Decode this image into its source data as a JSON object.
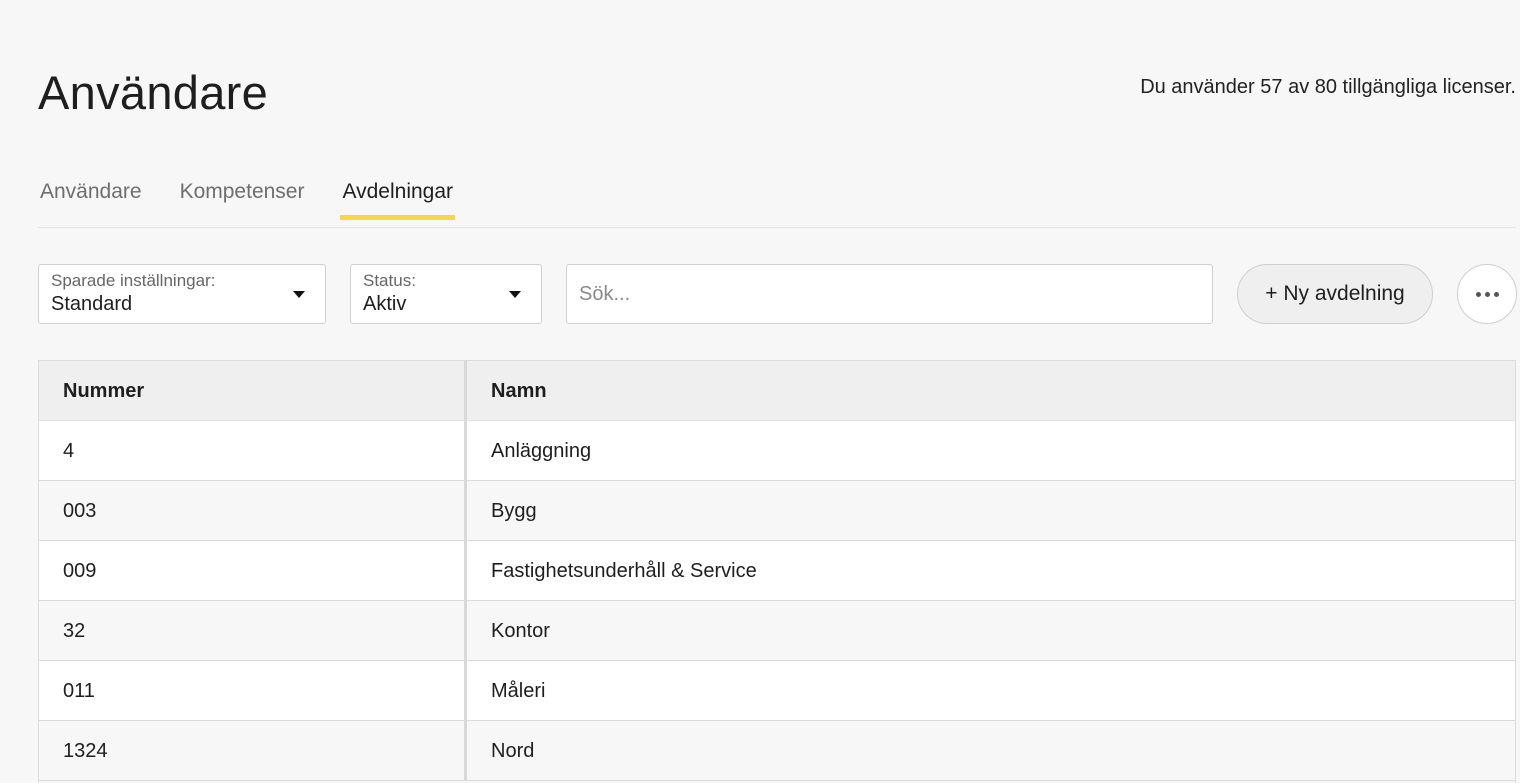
{
  "header": {
    "title": "Användare",
    "license_text": "Du använder 57 av 80 tillgängliga licenser."
  },
  "tabs": [
    {
      "label": "Användare",
      "active": false
    },
    {
      "label": "Kompetenser",
      "active": false
    },
    {
      "label": "Avdelningar",
      "active": true
    }
  ],
  "toolbar": {
    "saved_settings_label": "Sparade inställningar:",
    "saved_settings_value": "Standard",
    "status_label": "Status:",
    "status_value": "Aktiv",
    "search_placeholder": "Sök...",
    "new_button_label": "+ Ny avdelning"
  },
  "table": {
    "columns": [
      "Nummer",
      "Namn"
    ],
    "rows": [
      {
        "number": "4",
        "name": "Anläggning"
      },
      {
        "number": "003",
        "name": "Bygg"
      },
      {
        "number": "009",
        "name": "Fastighetsunderhåll & Service"
      },
      {
        "number": "32",
        "name": "Kontor"
      },
      {
        "number": "011",
        "name": "Måleri"
      },
      {
        "number": "1324",
        "name": "Nord"
      }
    ]
  },
  "colors": {
    "accent": "#f7d64a",
    "background": "#f7f7f7",
    "header_row": "#efefef"
  }
}
